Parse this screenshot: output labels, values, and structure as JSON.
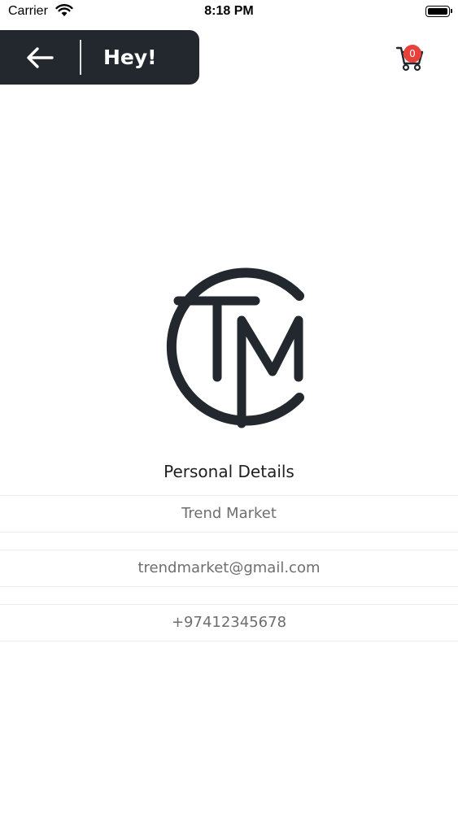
{
  "status_bar": {
    "carrier": "Carrier",
    "time": "8:18 PM",
    "icons": [
      "wifi-icon",
      "battery-icon"
    ]
  },
  "header": {
    "back_icon": "arrow-left-icon",
    "title": "Hey!",
    "background": "#22282d"
  },
  "cart": {
    "icon": "shopping-cart-icon",
    "count": "0",
    "badge_color": "#e8403a"
  },
  "logo": {
    "text": "TM",
    "color": "#22282d"
  },
  "personal_details": {
    "title": "Personal Details",
    "name": "Trend Market",
    "email": "trendmarket@gmail.com",
    "phone": "+97412345678"
  }
}
